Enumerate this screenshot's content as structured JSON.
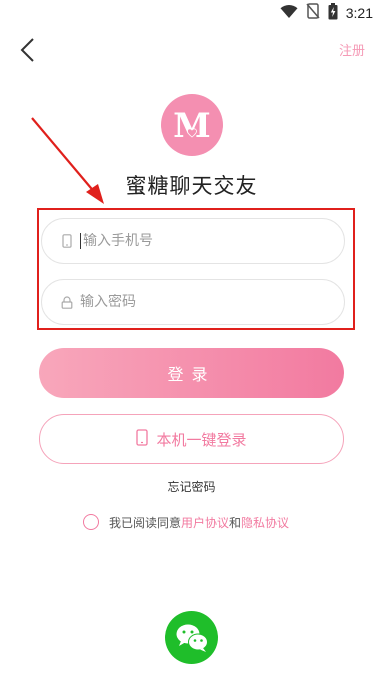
{
  "status_bar": {
    "time": "3:21",
    "icons": [
      "wifi-icon",
      "no-sim-icon",
      "battery-charging-icon"
    ]
  },
  "header": {
    "back_icon": "chevron-left-icon",
    "register_label": "注册"
  },
  "brand": {
    "logo_letter": "M",
    "title": "蜜糖聊天交友"
  },
  "form": {
    "phone": {
      "placeholder": "输入手机号",
      "value": "",
      "icon": "phone-icon"
    },
    "password": {
      "placeholder": "输入密码",
      "value": "",
      "icon": "lock-icon"
    }
  },
  "buttons": {
    "login_label": "登录",
    "onekey_label": "本机一键登录"
  },
  "forgot_label": "忘记密码",
  "agreement": {
    "prefix": "我已阅读同意",
    "user_link": "用户协议",
    "conj": "和",
    "privacy_link": "隐私协议"
  },
  "social": {
    "wechat_icon": "wechat-icon"
  },
  "colors": {
    "accent": "#f27aa0",
    "accent_light": "#f8a7bb",
    "annotation_red": "#e0201c",
    "wechat_green": "#1fbe2a"
  }
}
